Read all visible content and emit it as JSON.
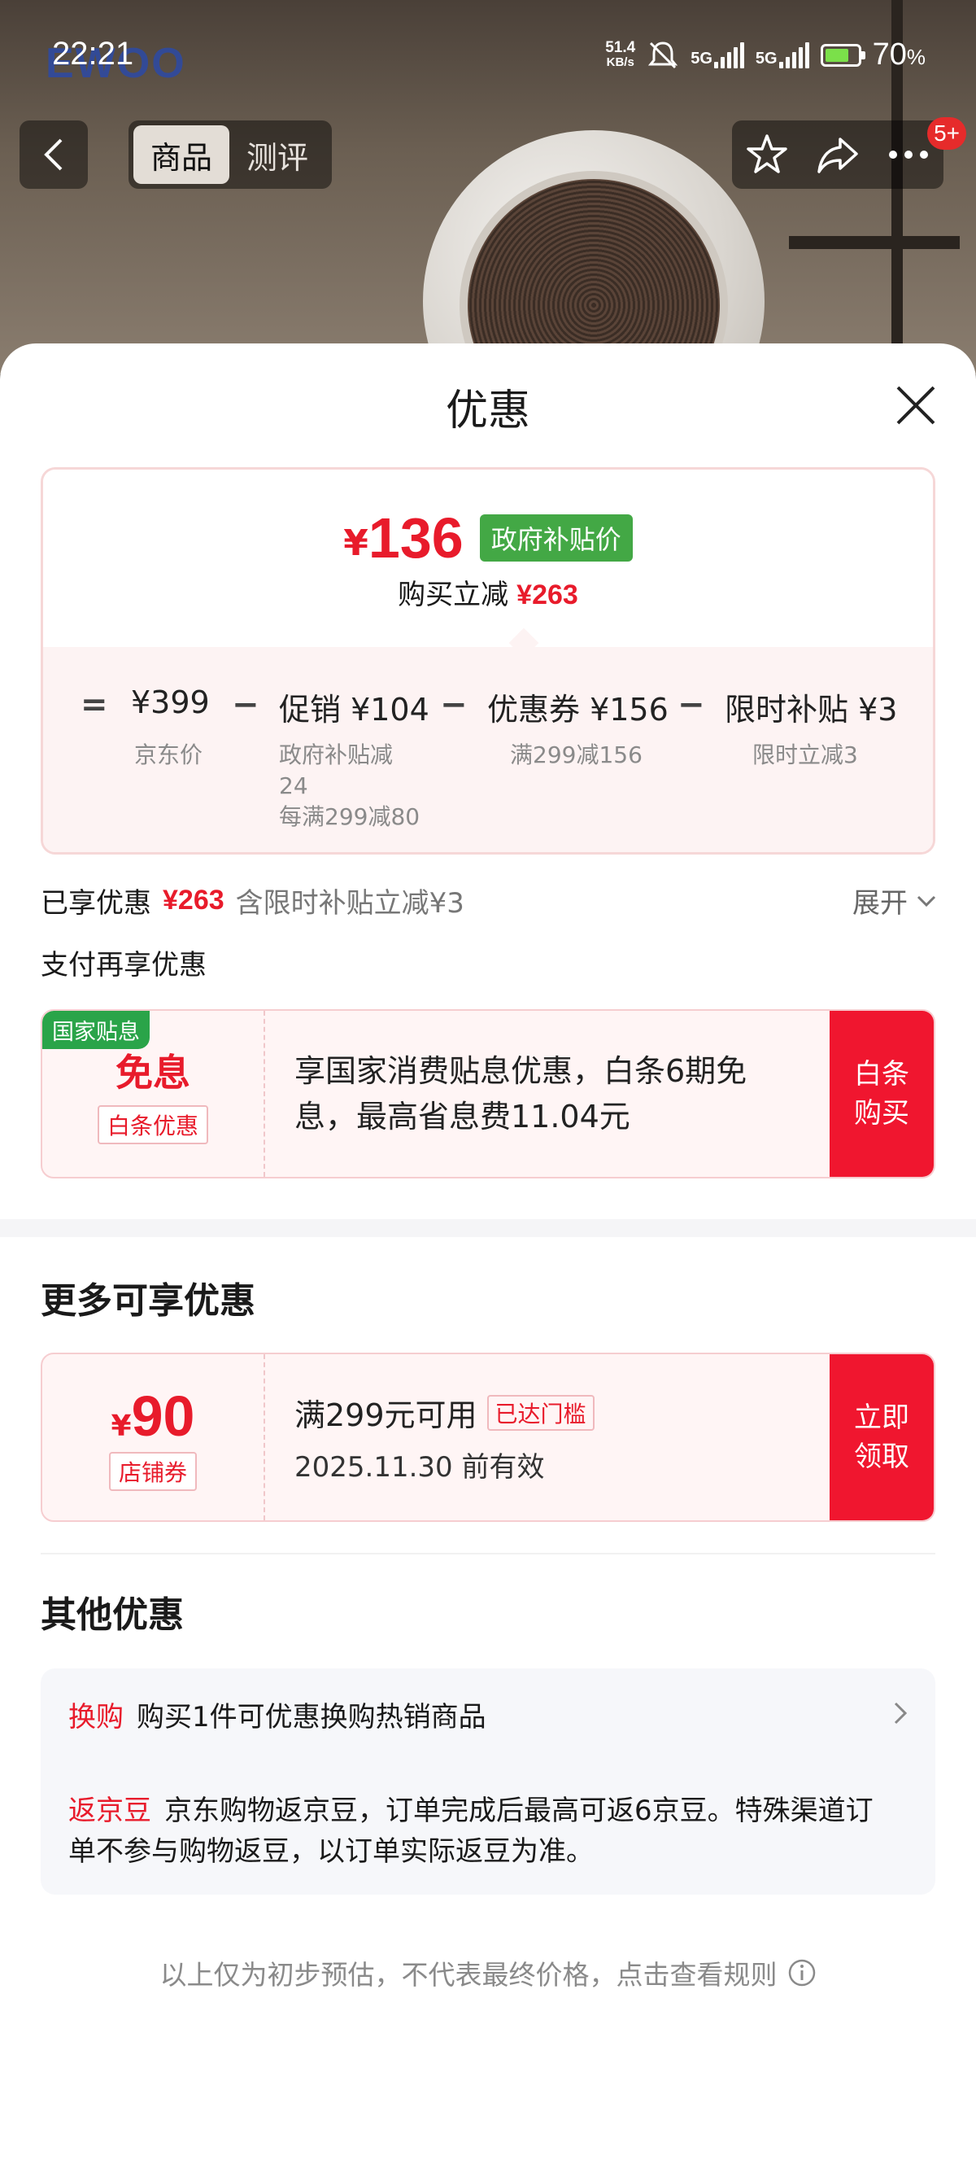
{
  "status_bar": {
    "time": "22:21",
    "net_speed_value": "51.4",
    "net_speed_unit": "KB/s",
    "sig1": "5G",
    "sig2": "5G",
    "battery": "70",
    "battery_unit": "%"
  },
  "background": {
    "brand_logo": "EWOO"
  },
  "nav": {
    "tab_product": "商品",
    "tab_review": "测评",
    "badge": "5+"
  },
  "sheet": {
    "title": "优惠",
    "price": {
      "currency": "¥",
      "amount": "136",
      "tag": "政府补贴价",
      "reduce_label": "购买立减",
      "reduce_value": "¥263"
    },
    "formula": {
      "eq": "=",
      "minus": "−",
      "items": [
        {
          "value": "¥399",
          "sub": "京东价"
        },
        {
          "value": "促销 ¥104",
          "sub": "政府补贴减24",
          "sub2": "每满299减80"
        },
        {
          "value": "优惠券 ¥156",
          "sub": "满299减156"
        },
        {
          "value": "限时补贴 ¥3",
          "sub": "限时立减3"
        }
      ]
    },
    "enjoyed": {
      "label": "已享优惠",
      "value": "¥263",
      "note": "含限时补贴立减¥3",
      "expand": "展开"
    },
    "pay_title": "支付再享优惠",
    "baitiao_card": {
      "corner": "国家贴息",
      "big": "免息",
      "tag": "白条优惠",
      "text": "享国家消费贴息优惠，白条6期免息，最高省息费11.04元",
      "button": "白条购买"
    },
    "more_title": "更多可享优惠",
    "coupon_card": {
      "currency": "¥",
      "amount": "90",
      "tag": "店铺券",
      "condition": "满299元可用",
      "status": "已达门槛",
      "expiry": "2025.11.30 前有效",
      "button": "立即领取"
    },
    "other_title": "其他优惠",
    "other": [
      {
        "label": "换购",
        "text": "购买1件可优惠换购热销商品"
      },
      {
        "label": "返京豆",
        "text": "京东购物返京豆，订单完成后最高可返6京豆。特殊渠道订单不参与购物返豆，以订单实际返豆为准。"
      }
    ],
    "footnote": "以上仅为初步预估，不代表最终价格，点击查看规则"
  },
  "colors": {
    "accent_red": "#e81b2b",
    "button_red": "#f0162f",
    "green_tag": "#43a845"
  }
}
